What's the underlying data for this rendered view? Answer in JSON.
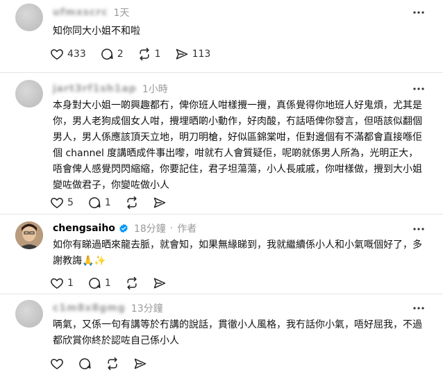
{
  "posts": [
    {
      "username": "ufmxscrc",
      "time": "1天",
      "text": "知你同大小姐不和啦",
      "likes": "433",
      "replies": "2",
      "reposts": "1",
      "shares": "113"
    },
    {
      "username": "jart3rf1sh1ap",
      "time": "1小時",
      "text": "本身對大小姐一啲興趣都冇，俾你班人咁樣攪一攪，真係覺得你地班人好鬼煩，尤其是你，男人老狗成個女人咁，攪埋晒啲小動作，好肉酸，冇話唔俾你發言，但唔該似翻個男人，男人係應該頂天立地，明刀明槍，好似區錦棠咁，佢對邊個有不滿都會直接喺佢個 channel 度講晒成件事出嚟，咁就冇人會質疑佢，呢啲就係男人所為，光明正大，唔會俾人感覺閃閃縮縮，你要記住，君子坦蕩蕩，小人長戚戚，你咁樣做，攪到大小姐變咗做君子，你變咗做小人",
      "likes": "5",
      "replies": "1"
    },
    {
      "username": "chengsaiho",
      "time": "18分鐘",
      "dot": "·",
      "author_label": "作者",
      "text": "如你有睇過晒來龍去脈，就會知，如果無緣睇到，我就繼續係小人和小氣嘅個好了，多謝教誨🙏✨",
      "likes": "1",
      "replies": "1"
    },
    {
      "username": "c1m8x8gmg",
      "time": "13分鐘",
      "text": "唡氣，又係一句有講等於冇講的說話，貫徹小人風格，我冇話你小氣，唔好屈我，不過都欣賞你終於認咗自己係小人"
    }
  ],
  "icons": {
    "like": "heart-icon",
    "reply": "comment-icon",
    "repost": "repost-icon",
    "share": "share-icon",
    "more": "more-icon",
    "verified": "verified-badge-icon"
  },
  "colors": {
    "verified": "#0095f6",
    "muted": "#999999"
  }
}
